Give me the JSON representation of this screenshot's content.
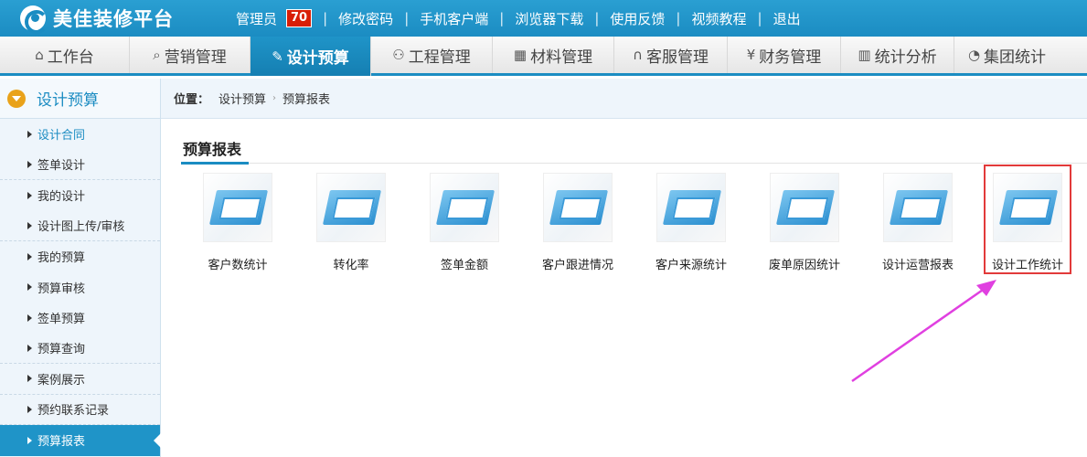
{
  "app": {
    "title": "美佳装修平台"
  },
  "toplinks": {
    "admin": "管理员",
    "admin_badge": "70",
    "change_password": "修改密码",
    "mobile_client": "手机客户端",
    "browser_download": "浏览器下载",
    "feedback": "使用反馈",
    "video_tutorial": "视频教程",
    "logout": "退出"
  },
  "nav": [
    {
      "label": "工作台",
      "icon": "home-icon"
    },
    {
      "label": "营销管理",
      "icon": "chat-icon"
    },
    {
      "label": "设计预算",
      "icon": "edit-icon"
    },
    {
      "label": "工程管理",
      "icon": "users-icon"
    },
    {
      "label": "材料管理",
      "icon": "grid-icon"
    },
    {
      "label": "客服管理",
      "icon": "headset-icon"
    },
    {
      "label": "财务管理",
      "icon": "yen-icon"
    },
    {
      "label": "统计分析",
      "icon": "bar-chart-icon"
    },
    {
      "label": "集团统计",
      "icon": "pie-chart-icon"
    }
  ],
  "nav_icons": {
    "home": "⌂",
    "chat": "⌕",
    "edit": "✎",
    "users": "⚇",
    "grid": "▦",
    "headset": "∩",
    "yen": "¥",
    "bar": "▥",
    "pie": "◔"
  },
  "sidebar": {
    "title": "设计预算",
    "items": [
      {
        "label": "设计合同"
      },
      {
        "label": "签单设计"
      },
      {
        "label": "我的设计"
      },
      {
        "label": "设计图上传/审核"
      },
      {
        "label": "我的预算"
      },
      {
        "label": "预算审核"
      },
      {
        "label": "签单预算"
      },
      {
        "label": "预算查询"
      },
      {
        "label": "案例展示"
      },
      {
        "label": "预约联系记录"
      },
      {
        "label": "预算报表"
      }
    ]
  },
  "breadcrumb": {
    "label": "位置：",
    "level1": "设计预算",
    "level2": "预算报表",
    "separator": "›"
  },
  "section": {
    "title": "预算报表"
  },
  "tiles": [
    {
      "label": "客户数统计"
    },
    {
      "label": "转化率"
    },
    {
      "label": "签单金额"
    },
    {
      "label": "客户跟进情况"
    },
    {
      "label": "客户来源统计"
    },
    {
      "label": "废单原因统计"
    },
    {
      "label": "设计运营报表"
    },
    {
      "label": "设计工作统计"
    }
  ],
  "colors": {
    "brand": "#1b8cc2",
    "highlight": "#e23a3a",
    "arrow": "#e040e0",
    "badge": "#d81e06"
  }
}
